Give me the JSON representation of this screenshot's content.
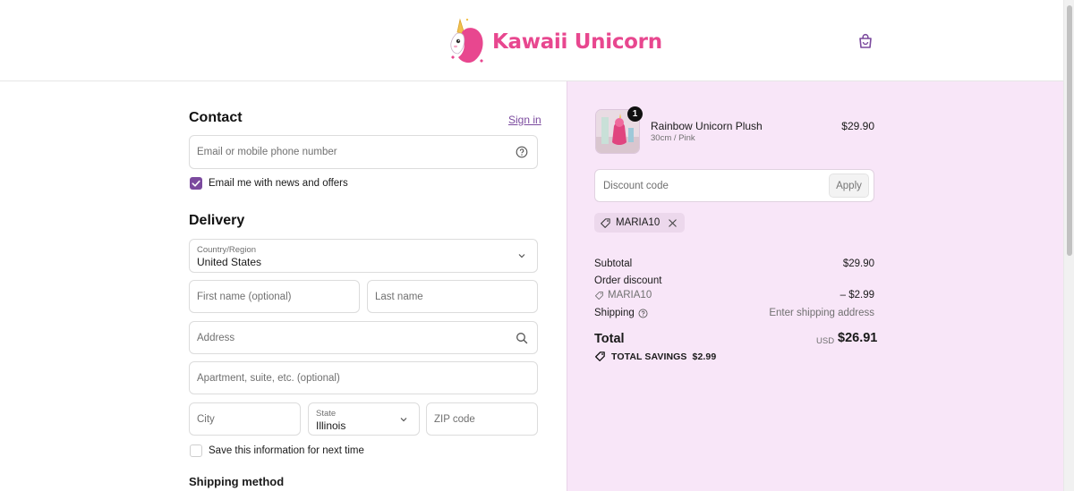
{
  "brand": {
    "name": "Kawaii Unicorn",
    "accent": "#e8478f",
    "primary": "#7b4a9e"
  },
  "header": {
    "cart_icon": "shopping-bag-icon"
  },
  "contact": {
    "title": "Contact",
    "sign_in": "Sign in",
    "email_placeholder": "Email or mobile phone number",
    "help_icon": "question-circle-icon",
    "newsletter_label": "Email me with news and offers",
    "newsletter_checked": true
  },
  "delivery": {
    "title": "Delivery",
    "country_label": "Country/Region",
    "country_value": "United States",
    "first_name_placeholder": "First name (optional)",
    "last_name_placeholder": "Last name",
    "address_placeholder": "Address",
    "apartment_placeholder": "Apartment, suite, etc. (optional)",
    "city_placeholder": "City",
    "state_label": "State",
    "state_value": "Illinois",
    "zip_placeholder": "ZIP code",
    "save_info_label": "Save this information for next time",
    "save_info_checked": false
  },
  "shipping_method": {
    "title": "Shipping method"
  },
  "summary": {
    "product": {
      "name": "Rainbow Unicorn Plush",
      "variant": "30cm / Pink",
      "price": "$29.90",
      "quantity": "1"
    },
    "discount_placeholder": "Discount code",
    "apply_label": "Apply",
    "applied_code": "MARIA10",
    "subtotal_label": "Subtotal",
    "subtotal_value": "$29.90",
    "order_discount_label": "Order discount",
    "order_discount_code": "MARIA10",
    "order_discount_value": "– $2.99",
    "shipping_label": "Shipping",
    "shipping_value": "Enter shipping address",
    "total_label": "Total",
    "total_currency": "USD",
    "total_value": "$26.91",
    "savings_label": "TOTAL SAVINGS",
    "savings_value": "$2.99"
  }
}
